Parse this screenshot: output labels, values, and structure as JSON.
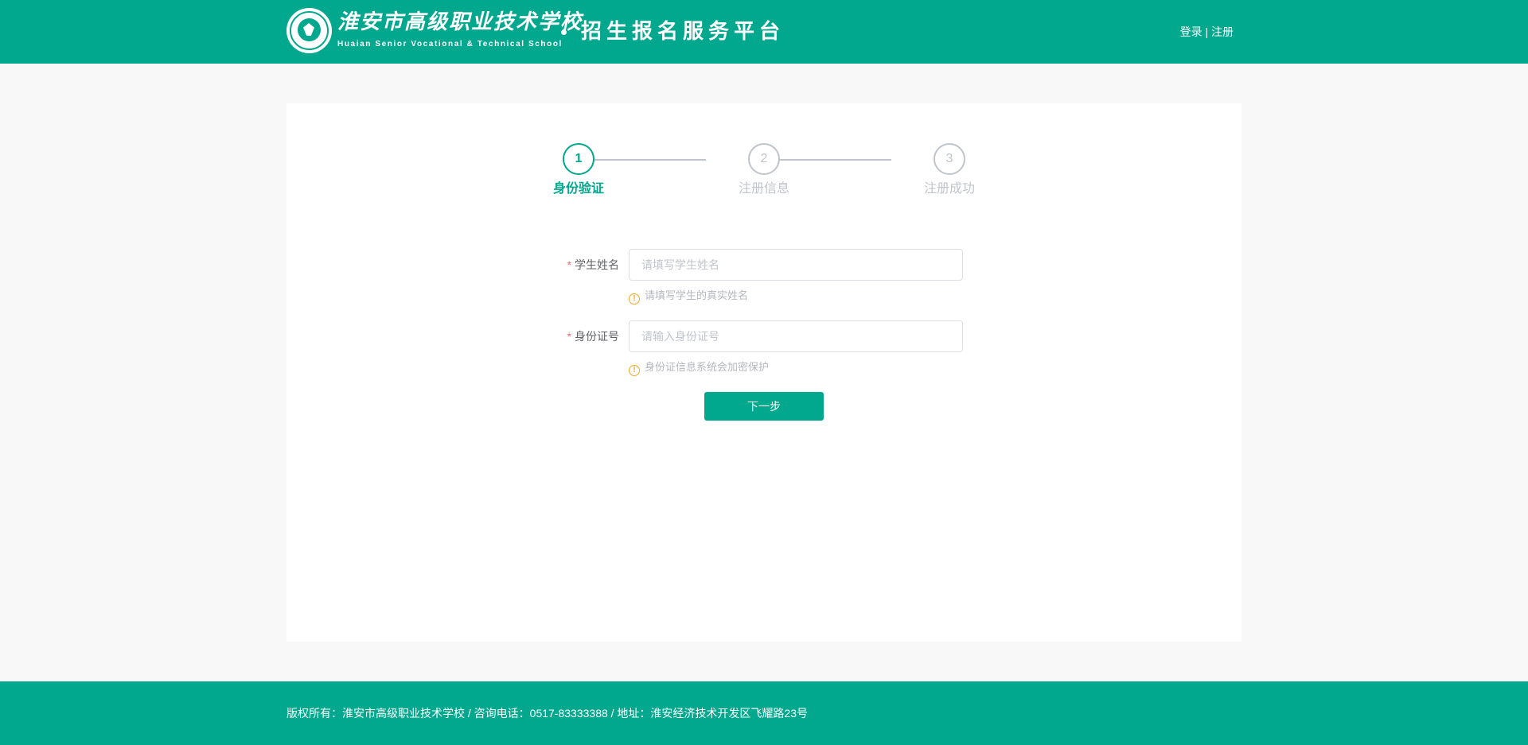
{
  "header": {
    "school_name_cn": "淮安市高级职业技术学校",
    "school_name_en": "Huaian Senior Vocational & Technical School",
    "platform_name": "招生报名服务平台",
    "login_label": "登录",
    "separator": " | ",
    "register_label": "注册",
    "logo_icon": "school-seal-icon"
  },
  "steps": [
    {
      "number": "1",
      "label": "身份验证",
      "state": "active"
    },
    {
      "number": "2",
      "label": "注册信息",
      "state": "pending"
    },
    {
      "number": "3",
      "label": "注册成功",
      "state": "pending"
    }
  ],
  "form": {
    "required_mark": "*",
    "student_name": {
      "label": "学生姓名",
      "value": "",
      "placeholder": "请填写学生姓名",
      "hint": "请填写学生的真实姓名",
      "hint_icon": "warning-circle-icon"
    },
    "id_number": {
      "label": "身份证号",
      "value": "",
      "placeholder": "请输入身份证号",
      "hint": "身份证信息系统会加密保护",
      "hint_icon": "warning-circle-icon"
    },
    "hint_icon_glyph": "!",
    "next_button_label": "下一步"
  },
  "footer": {
    "text": "版权所有：淮安市高级职业技术学校 / 咨询电话：0517-83333388 / 地址：淮安经济技术开发区飞耀路23号"
  },
  "colors": {
    "brand": "#02a88e",
    "inactive": "#c0c4cc",
    "required": "#f56c6c",
    "hint_icon": "#f5a623",
    "page_background": "#f8f8f8"
  }
}
